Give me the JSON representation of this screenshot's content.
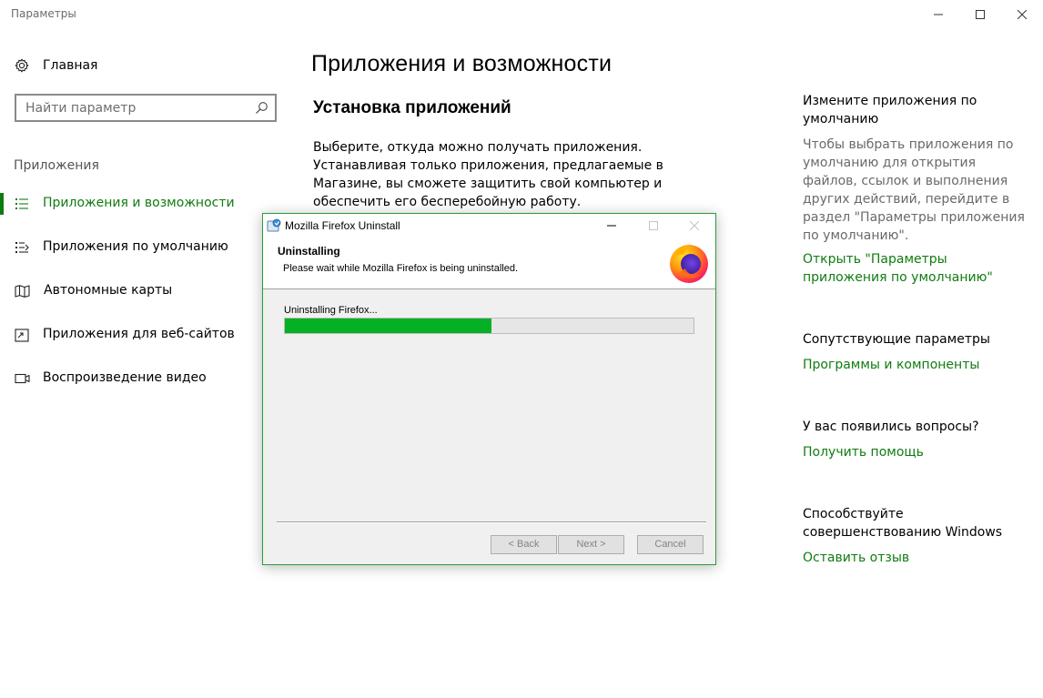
{
  "window": {
    "title": "Параметры"
  },
  "sidebar": {
    "home_label": "Главная",
    "search_placeholder": "Найти параметр",
    "section_label": "Приложения",
    "items": [
      {
        "label": "Приложения и возможности",
        "icon": "apps-list-icon",
        "active": true
      },
      {
        "label": "Приложения по умолчанию",
        "icon": "default-apps-icon",
        "active": false
      },
      {
        "label": "Автономные карты",
        "icon": "map-icon",
        "active": false
      },
      {
        "label": "Приложения для веб-сайтов",
        "icon": "web-apps-icon",
        "active": false
      },
      {
        "label": "Воспроизведение видео",
        "icon": "video-icon",
        "active": false
      }
    ]
  },
  "main": {
    "title": "Приложения и возможности",
    "subsection_title": "Установка приложений",
    "description": "Выберите, откуда можно получать приложения. Устанавливая только приложения, предлагаемые в Магазине, вы сможете защитить свой компьютер и обеспечить его бесперебойную работу."
  },
  "right_panel": {
    "defaults_heading": "Измените приложения по умолчанию",
    "defaults_text": "Чтобы выбрать приложения по умолчанию для открытия файлов, ссылок и выполнения других действий, перейдите в раздел \"Параметры приложения по умолчанию\".",
    "defaults_link": "Открыть \"Параметры приложения по умолчанию\"",
    "related_heading": "Сопутствующие параметры",
    "related_link": "Программы и компоненты",
    "questions_heading": "У вас появились вопросы?",
    "help_link": "Получить помощь",
    "feedback_heading": "Способствуйте совершенствованию Windows",
    "feedback_link": "Оставить отзыв"
  },
  "dialog": {
    "title": "Mozilla Firefox Uninstall",
    "heading": "Uninstalling",
    "subheading": "Please wait while Mozilla Firefox is being uninstalled.",
    "status": "Uninstalling Firefox...",
    "progress_fraction": 0.505,
    "back_label": "< Back",
    "next_label": "Next >",
    "cancel_label": "Cancel"
  },
  "colors": {
    "accent": "#107c10",
    "progress": "#06b025",
    "dialog_border": "#2a9d3a"
  }
}
